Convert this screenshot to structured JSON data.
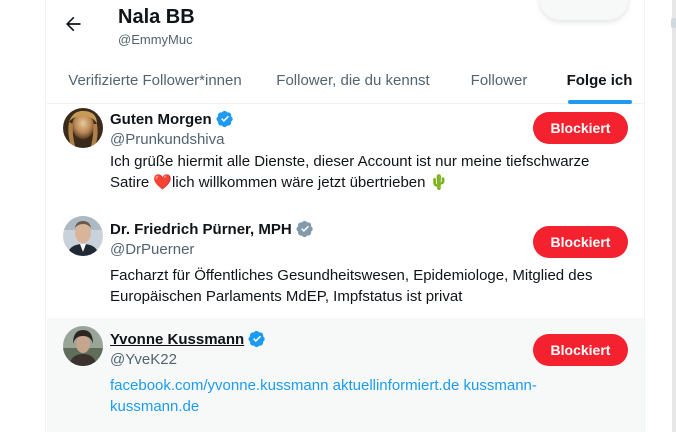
{
  "header": {
    "title": "Nala BB",
    "subtitle": "@EmmyMuc"
  },
  "tabs": [
    {
      "label": "Verifizierte Follower*innen",
      "active": false
    },
    {
      "label": "Follower, die du kennst",
      "active": false
    },
    {
      "label": "Follower",
      "active": false
    },
    {
      "label": "Folge ich",
      "active": true
    }
  ],
  "users": [
    {
      "name": "Guten Morgen",
      "handle": "@Prunkundshiva",
      "bio_line1": "Ich grüße hiermit alle Dienste, dieser Account ist nur meine tiefschwarze",
      "bio_line2_a": "Satire ",
      "bio_line2_heart": "❤️",
      "bio_line2_b": "lich willkommen wäre jetzt übertrieben ",
      "bio_line2_cactus": "🌵",
      "button": "Blockiert",
      "verified": "blue"
    },
    {
      "name": "Dr. Friedrich Pürner, MPH",
      "handle": "@DrPuerner",
      "bio_line1": "Facharzt für Öffentliches Gesundheitswesen, Epidemiologe, Mitglied des",
      "bio_line2": "Europäischen Parlaments MdEP, Impfstatus ist privat",
      "button": "Blockiert",
      "verified": "gray"
    },
    {
      "name": "Yvonne Kussmann",
      "handle": "@YveK22",
      "bio_line1": "facebook.com/yvonne.kussmann aktuellinformiert.de kussmann-",
      "bio_line2": "kussmann.de",
      "button": "Blockiert",
      "verified": "blue"
    }
  ],
  "colors": {
    "accent": "#1d9bf0",
    "block": "#f4212e",
    "secondary_text": "#536471",
    "verified_gray": "#829aab"
  }
}
